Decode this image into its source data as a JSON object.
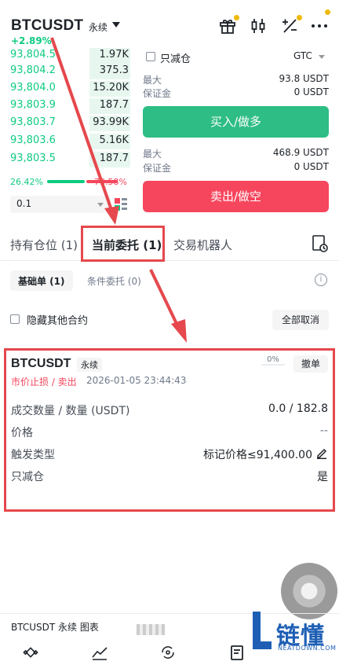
{
  "header": {
    "symbol": "BTCUSDT",
    "contract_type": "永续",
    "change": "+2.89%"
  },
  "order_book": {
    "rows": [
      {
        "price": "93,804.5",
        "qty": "1.97K"
      },
      {
        "price": "93,804.2",
        "qty": "375.3"
      },
      {
        "price": "93,804.0",
        "qty": "15.20K"
      },
      {
        "price": "93,803.9",
        "qty": "187.7"
      },
      {
        "price": "93,803.7",
        "qty": "93.99K"
      },
      {
        "price": "93,803.6",
        "qty": "5.16K"
      },
      {
        "price": "93,803.5",
        "qty": "187.7"
      }
    ],
    "buy_ratio": "26.42%",
    "sell_ratio": "73.58%",
    "depth": "0.1"
  },
  "form": {
    "reduce_only_label": "只减仓",
    "tif": "GTC",
    "buy_max_label": "最大",
    "buy_max_value": "93.8 USDT",
    "buy_margin_label": "保证金",
    "buy_margin_value": "0 USDT",
    "buy_button": "买入/做多",
    "sell_max_label": "最大",
    "sell_max_value": "468.9 USDT",
    "sell_margin_label": "保证金",
    "sell_margin_value": "0 USDT",
    "sell_button": "卖出/做空"
  },
  "tabs": {
    "positions": "持有仓位 (1)",
    "open_orders": "当前委托 (1)",
    "bots": "交易机器人"
  },
  "subtabs": {
    "basic": "基础单 (1)",
    "conditional": "条件委托 (0)"
  },
  "filter": {
    "hide_other_label": "隐藏其他合约",
    "cancel_all": "全部取消"
  },
  "order": {
    "symbol": "BTCUSDT",
    "contract_type": "永续",
    "progress": "0%",
    "cancel": "撤单",
    "type": "市价止损 / 卖出",
    "time": "2026-01-05 23:44:43",
    "rows": [
      {
        "label": "成交数量 / 数量 (USDT)",
        "value": "0.0 / 182.8"
      },
      {
        "label": "价格",
        "value": "--"
      },
      {
        "label": "触发类型",
        "value": "标记价格≤91,400.00"
      },
      {
        "label": "只减仓",
        "value": "是"
      }
    ]
  },
  "bottom": {
    "chart_label": "BTCUSDT 永续  图表"
  },
  "watermark": {
    "cn": "链懂",
    "en": "NEATDOWN.COM"
  },
  "colors": {
    "green": "#0ecb81",
    "red": "#f6465d",
    "accent": "#f0b90b",
    "annotation": "#e5484d"
  }
}
